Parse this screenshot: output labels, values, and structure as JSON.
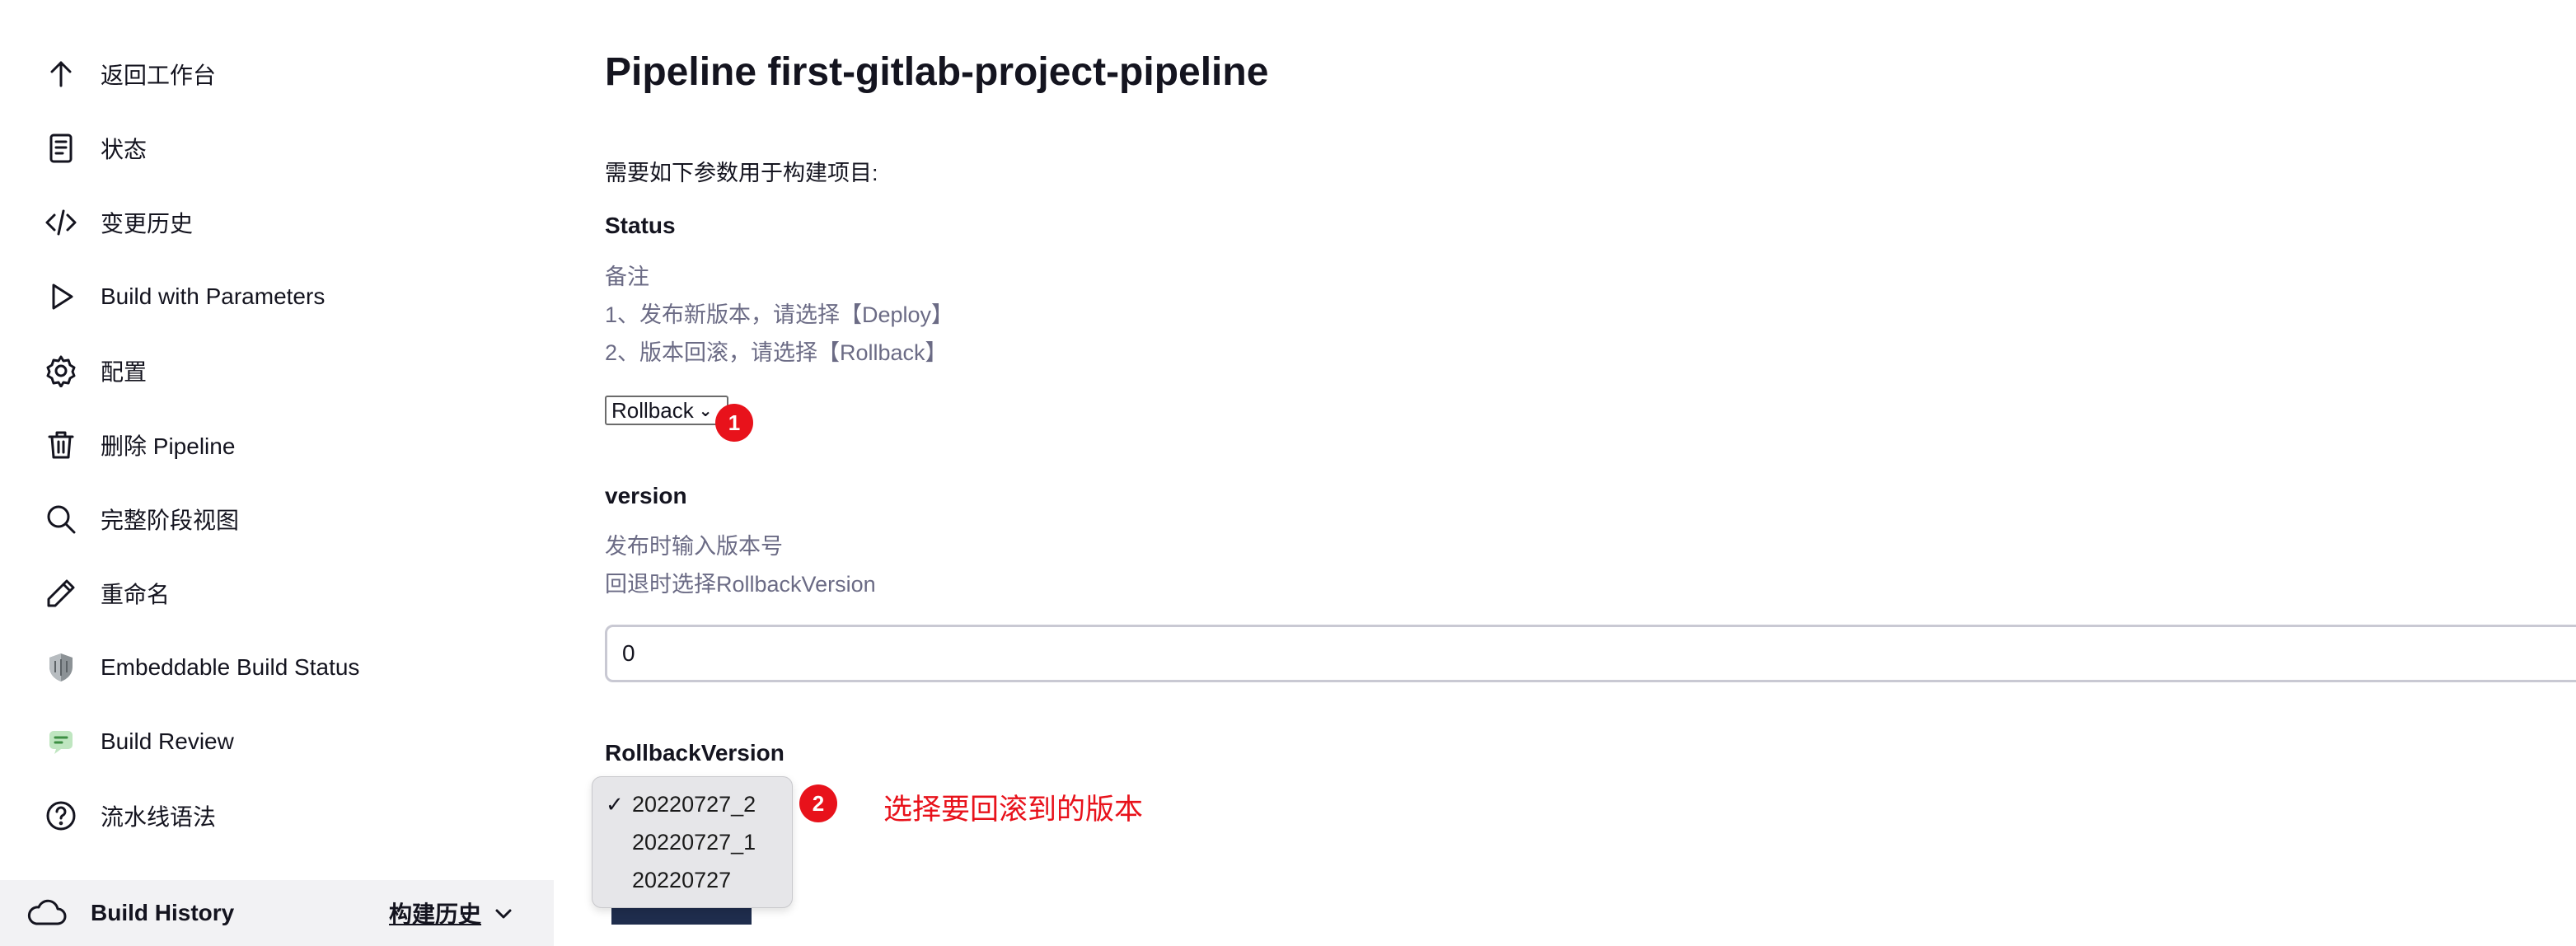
{
  "sidebar": {
    "items": [
      {
        "label": "返回工作台",
        "icon": "arrow-up-icon"
      },
      {
        "label": "状态",
        "icon": "document-icon"
      },
      {
        "label": "变更历史",
        "icon": "code-icon"
      },
      {
        "label": "Build with Parameters",
        "icon": "play-icon"
      },
      {
        "label": "配置",
        "icon": "gear-icon"
      },
      {
        "label": "删除 Pipeline",
        "icon": "trash-icon"
      },
      {
        "label": "完整阶段视图",
        "icon": "search-icon"
      },
      {
        "label": "重命名",
        "icon": "pencil-icon"
      },
      {
        "label": "Embeddable Build Status",
        "icon": "shield-icon"
      },
      {
        "label": "Build Review",
        "icon": "review-icon"
      },
      {
        "label": "流水线语法",
        "icon": "help-icon"
      }
    ],
    "build_history": {
      "title": "Build History",
      "link": "构建历史",
      "icon": "cloud-icon"
    }
  },
  "main": {
    "title": "Pipeline first-gitlab-project-pipeline",
    "intro": "需要如下参数用于构建项目:",
    "status": {
      "name": "Status",
      "description": [
        "备注",
        "1、发布新版本，请选择【Deploy】",
        "2、版本回滚，请选择【Rollback】"
      ],
      "selected": "Rollback"
    },
    "version": {
      "name": "version",
      "description": [
        "发布时输入版本号",
        "回退时选择RollbackVersion"
      ],
      "value": "0"
    },
    "rollback_version": {
      "name": "RollbackVersion",
      "options": [
        "20220727_2",
        "20220727_1",
        "20220727"
      ],
      "selected": "20220727_2"
    },
    "markers": [
      "1",
      "2"
    ],
    "annotation": "选择要回滚到的版本"
  },
  "colors": {
    "accent_red": "#e8121b",
    "muted_text": "#6b6b85",
    "sidebar_footer_bg": "#f2f2f4"
  }
}
